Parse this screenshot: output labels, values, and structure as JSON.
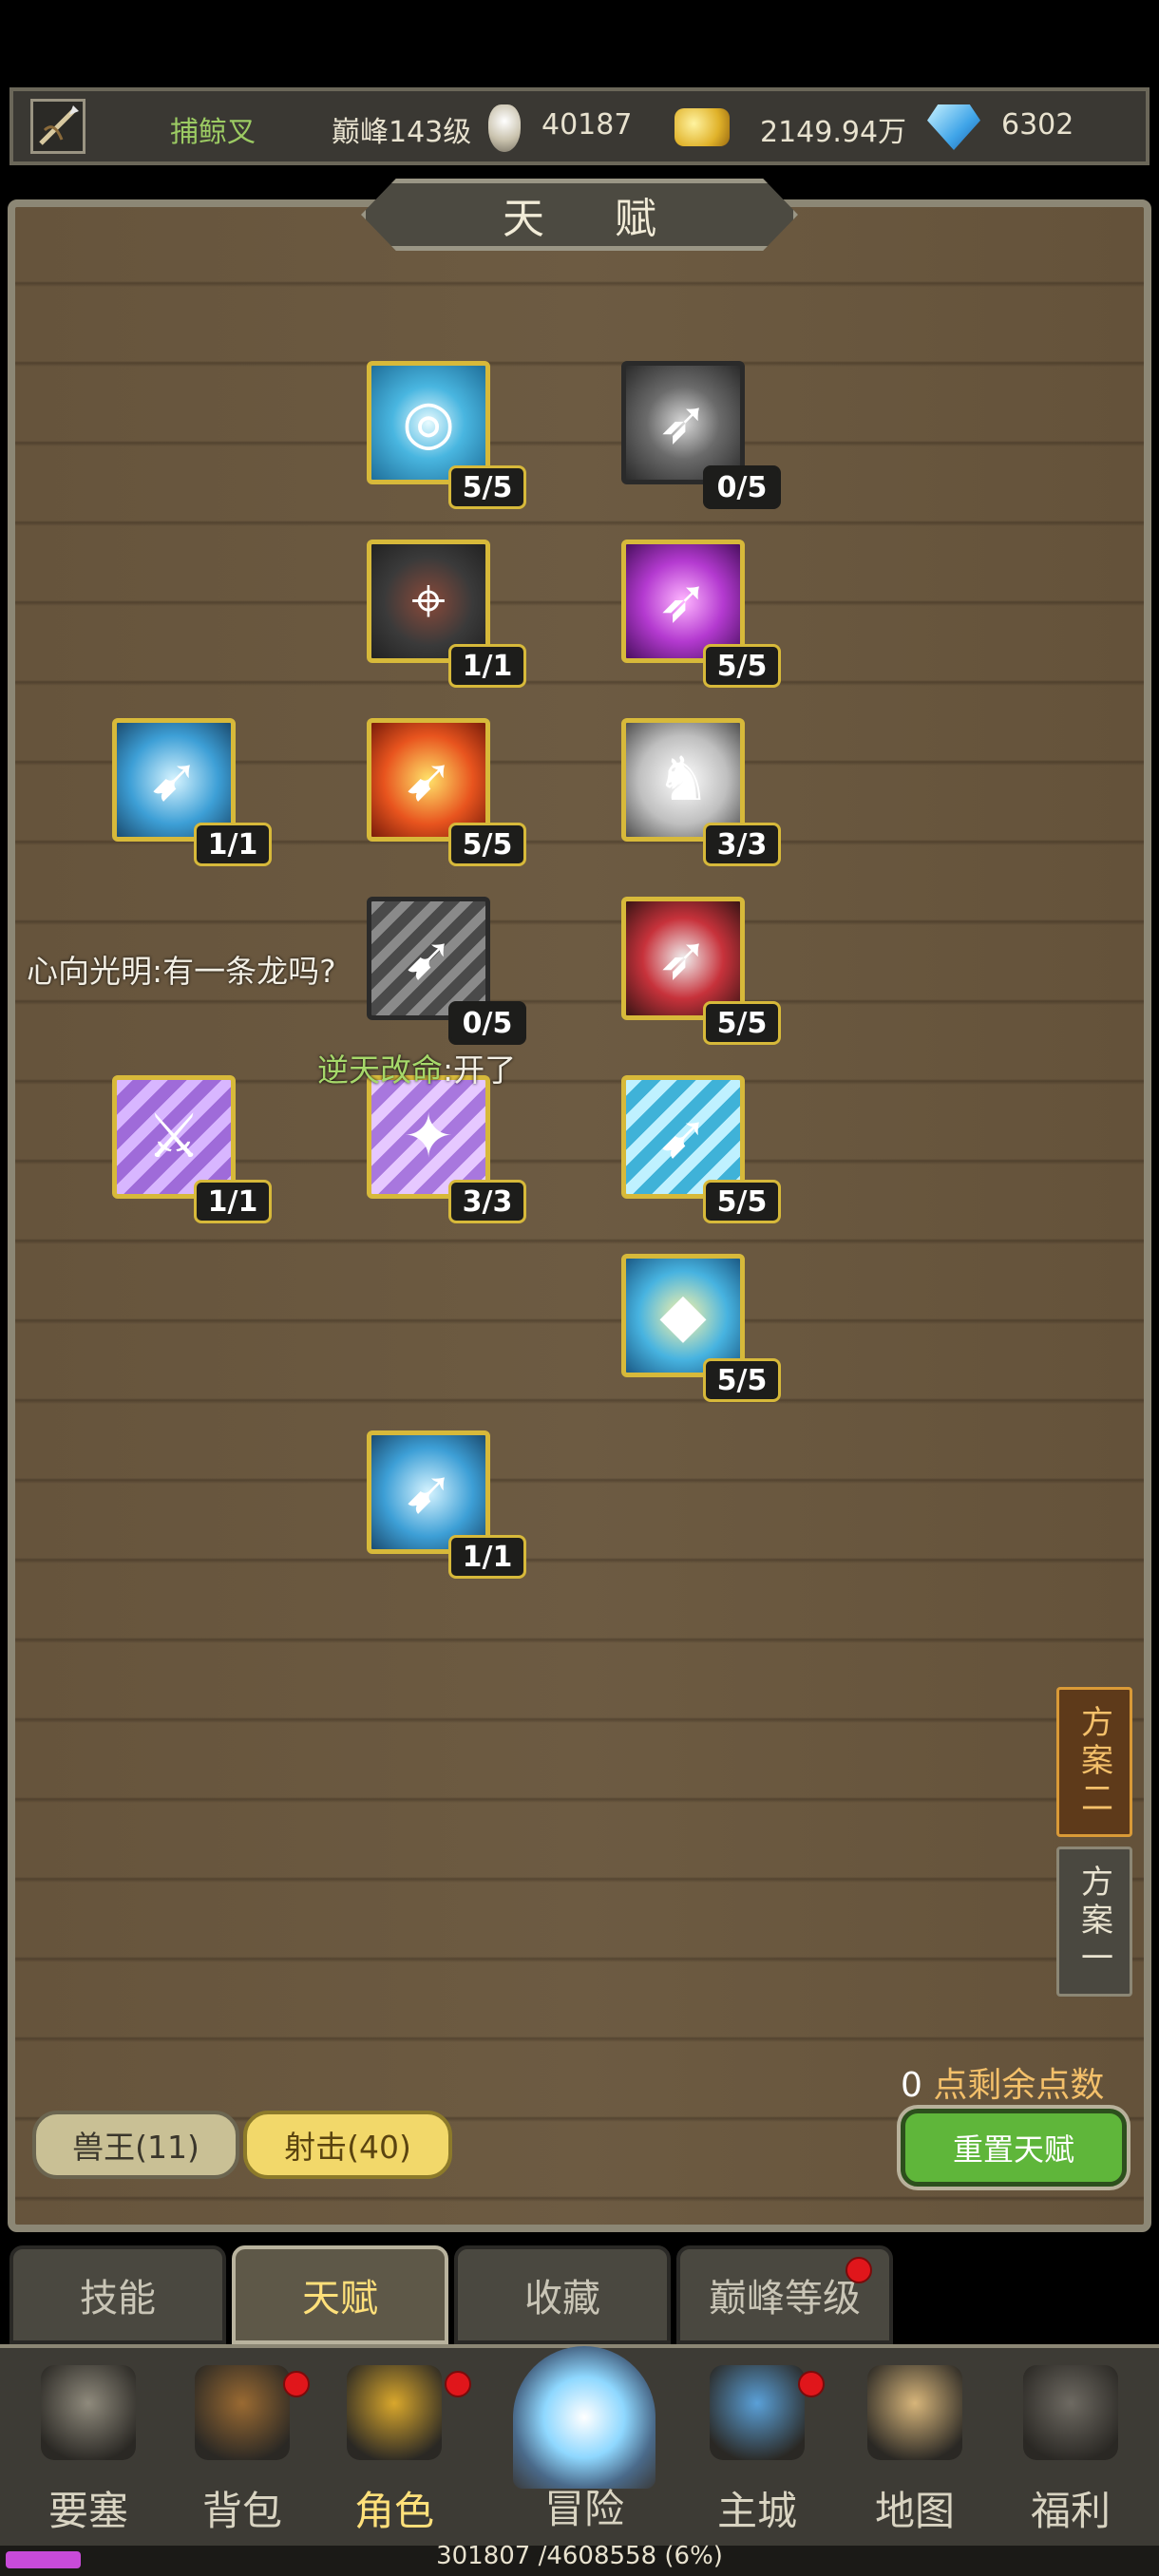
{
  "header": {
    "weapon_name": "捕鲸叉",
    "peak_level": "巅峰143级",
    "peak_points": "40187",
    "gold": "2149.94万",
    "diamonds": "6302"
  },
  "panel": {
    "title": "天 赋"
  },
  "talents": [
    {
      "rank": "5/5",
      "icon": "whirlpool-icon",
      "active": true
    },
    {
      "rank": "0/5",
      "icon": "target-arrow-icon",
      "active": false
    },
    {
      "rank": "1/1",
      "icon": "crosshair-skull-icon",
      "active": true
    },
    {
      "rank": "5/5",
      "icon": "purple-lightning-spear-icon",
      "active": true
    },
    {
      "rank": "1/1",
      "icon": "blue-spear-icon",
      "active": true
    },
    {
      "rank": "5/5",
      "icon": "fire-spear-icon",
      "active": true
    },
    {
      "rank": "3/3",
      "icon": "eagle-icon",
      "active": true
    },
    {
      "rank": "0/5",
      "icon": "grey-spear-icon",
      "active": false
    },
    {
      "rank": "5/5",
      "icon": "red-target-spear-icon",
      "active": true
    },
    {
      "rank": "1/1",
      "icon": "purple-dagger-icon",
      "active": true
    },
    {
      "rank": "3/3",
      "icon": "bat-icon",
      "active": true
    },
    {
      "rank": "5/5",
      "icon": "ice-spear-icon",
      "active": true
    },
    {
      "rank": "5/5",
      "icon": "gold-spear-icon",
      "active": true
    },
    {
      "rank": "1/1",
      "icon": "blue-spear-icon",
      "active": true
    }
  ],
  "chat": [
    {
      "text": "心向光明:有一条龙吗?"
    },
    {
      "name": "逆天改命",
      "text": ":开了"
    }
  ],
  "plans": [
    "方案二",
    "方案一"
  ],
  "remaining": {
    "count": "0",
    "label": "点剩余点数"
  },
  "branches": [
    "兽王(11)",
    "射击(40)"
  ],
  "reset_label": "重置天赋",
  "subtabs": [
    "技能",
    "天赋",
    "收藏",
    "巅峰等级"
  ],
  "nav": [
    "要塞",
    "背包",
    "角色",
    "冒险",
    "主城",
    "地图",
    "福利"
  ],
  "xp": {
    "text": "301807 /4608558 (6%)",
    "fraction": 0.065
  },
  "colors": {
    "gold_border": "#d7b93a",
    "panel_wood": "#6a5940",
    "accent_yellow": "#ffe07a"
  }
}
